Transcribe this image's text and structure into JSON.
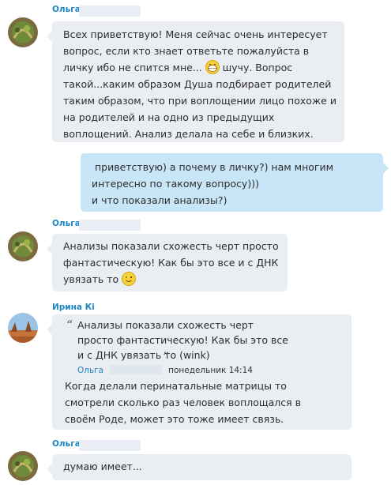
{
  "messages": [
    {
      "sender": "Ольга",
      "text": "Всех приветствую! Меня сейчас очень интересует вопрос, если кто знает ответьте пожалуйста в личку ибо не спится мне...",
      "text_after_emoji": "шучу. Вопрос такой...каким образом Душа подбирает родителей таким образом, что при воплощении лицо похоже и на родителей и на одно из предыдущих воплощений. Анализ делала на себе и близких."
    },
    {
      "sender": "",
      "lines": [
        " приветствую) а почему в личку?) нам многим",
        "интересно по такому вопросу)))",
        "и что показали анализы?)"
      ]
    },
    {
      "sender": "Ольга",
      "text": "Анализы показали схожесть черт просто фантастическую! Как бы это все и с ДНК увязать то"
    },
    {
      "sender": "Ирина Кі",
      "quote_text": "Анализы показали схожесть черт просто фантастическую! Как бы это все и с ДНК увязать то (wink)",
      "quote_author": "Ольга",
      "quote_time": "понедельник 14:14",
      "text": "Когда делали перинатальные матрицы то смотрели сколько раз человек воплощался в своём Роде, может это тоже имеет связь."
    },
    {
      "sender": "Ольга",
      "text": "думаю имеет..."
    }
  ],
  "colors": {
    "name": "#1f86c4",
    "bubble_in": "#eaeef3",
    "bubble_out": "#c8e6f7"
  },
  "icons": [
    "grin-emoji",
    "wink-emoji",
    "avatar-plant",
    "avatar-landscape"
  ]
}
